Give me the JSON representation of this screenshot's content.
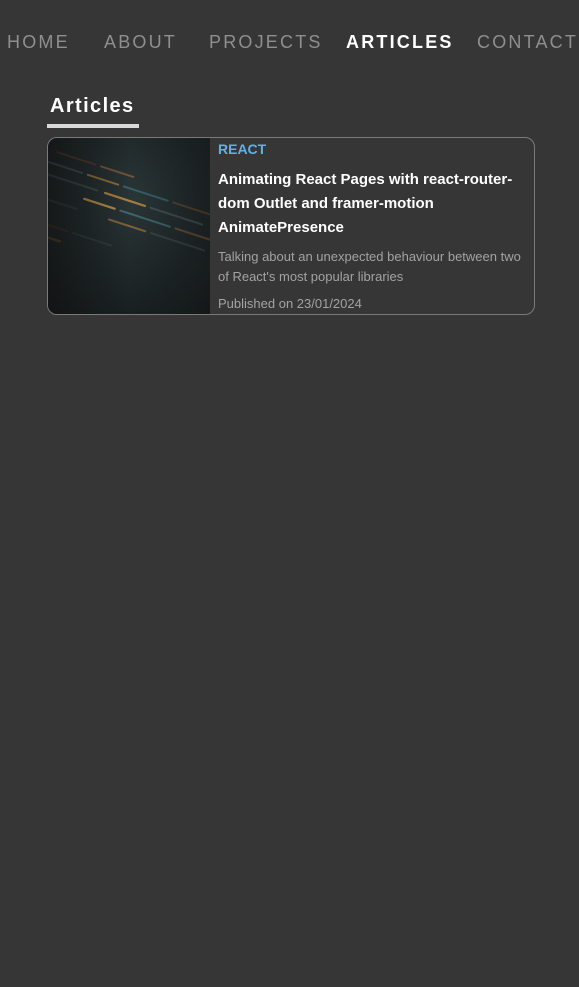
{
  "nav": {
    "items": [
      {
        "label": "HOME",
        "active": false
      },
      {
        "label": "ABOUT",
        "active": false
      },
      {
        "label": "PROJECTS",
        "active": false
      },
      {
        "label": "ARTICLES",
        "active": true
      },
      {
        "label": "CONTACT",
        "active": false
      }
    ]
  },
  "page": {
    "title": "Articles"
  },
  "articles": [
    {
      "tag": "REACT",
      "title": "Animating React Pages with react-router-dom Outlet and framer-motion AnimatePresence",
      "description": "Talking about an unexpected behaviour between two of React's most popular libraries",
      "date": "Published on 23/01/2024",
      "thumbnail": "code-editor-image"
    }
  ],
  "colors": {
    "background": "#363636",
    "nav_inactive": "#8f8f8f",
    "nav_active": "#ffffff",
    "tag": "#5fb2e6",
    "muted_text": "#a3a3a3",
    "card_border": "#7a7a7a"
  }
}
